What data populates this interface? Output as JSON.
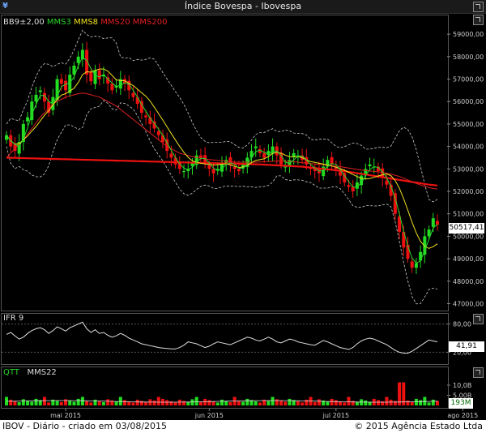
{
  "window": {
    "title": "Índice Bovespa - Ibovespa"
  },
  "legend_price": [
    {
      "label": "BB9±2,00",
      "color": "#dddddd"
    },
    {
      "label": "MMS3",
      "color": "#2bd42b"
    },
    {
      "label": "MMS8",
      "color": "#f0e020"
    },
    {
      "label": "MMS20",
      "color": "#e02020"
    },
    {
      "label": "MMS200",
      "color": "#e02020"
    }
  ],
  "legend_ifr": [
    {
      "label": "IFR 9",
      "color": "#dddddd"
    }
  ],
  "legend_qtt": [
    {
      "label": "QTT",
      "color": "#2bd42b"
    },
    {
      "label": "MMS22",
      "color": "#dddddd"
    }
  ],
  "footer": {
    "left": "IBOV - Diário - criado em 03/08/2015",
    "right": "© 2015 Agência Estado Ltda"
  },
  "colors": {
    "up": "#22dd22",
    "down": "#ee1111",
    "mms3": "#2bd42b",
    "mms8": "#f0e020",
    "mms20": "#dd2020",
    "mms200": "#ee1111",
    "band": "#cccccc",
    "ifr": "#dddddd",
    "mms22": "#dddddd"
  },
  "chart_data": [
    {
      "type": "candlestick",
      "x_labels": [
        "mai 2015",
        "jun 2015",
        "jul 2015",
        "ago 2015"
      ],
      "x_label_index": [
        14,
        48,
        78,
        108
      ],
      "y_ticks": [
        47000,
        48000,
        49000,
        50000,
        51000,
        52000,
        53000,
        54000,
        55000,
        56000,
        57000,
        58000,
        59000
      ],
      "y_tick_labels": [
        "47000,00",
        "48000,00",
        "49000,00",
        "50000,00",
        "51000,00",
        "52000,00",
        "53000,00",
        "54000,00",
        "55000,00",
        "56000,00",
        "57000,00",
        "58000,00",
        "59000,00"
      ],
      "ylim": [
        46800,
        59800
      ],
      "last_value": "50517,41",
      "close": [
        54500,
        54000,
        53800,
        54200,
        55000,
        55300,
        56000,
        56300,
        56500,
        56000,
        55500,
        56200,
        57000,
        56800,
        56500,
        57200,
        57600,
        58000,
        58300,
        57200,
        56900,
        57400,
        57000,
        57200,
        56800,
        56500,
        56700,
        57000,
        56800,
        56500,
        56200,
        55900,
        55500,
        55300,
        55000,
        54800,
        54500,
        54200,
        53800,
        53500,
        53200,
        53000,
        52900,
        53000,
        53300,
        53600,
        53500,
        53300,
        53000,
        52800,
        53000,
        53200,
        53400,
        53200,
        53000,
        52900,
        53200,
        53500,
        53800,
        54000,
        53700,
        53500,
        53800,
        54000,
        53600,
        53200,
        53100,
        53400,
        53700,
        53600,
        53400,
        53200,
        53000,
        52900,
        52800,
        53100,
        53400,
        53200,
        53000,
        52700,
        52400,
        52200,
        52000,
        52400,
        52700,
        53000,
        53200,
        53100,
        52900,
        52600,
        52300,
        51800,
        51000,
        50200,
        49500,
        49000,
        48600,
        48800,
        49300,
        50000,
        50300,
        50800,
        50517
      ],
      "mms20": [
        53500,
        53700,
        53900,
        54100,
        54300,
        54550,
        54800,
        55050,
        55300,
        55500,
        55700,
        55900,
        56000,
        56100,
        56200,
        56250,
        56300,
        56350,
        56380,
        56350,
        56300,
        56250,
        56200,
        56100,
        56000,
        55900,
        55800,
        55650,
        55500,
        55350,
        55200,
        55050,
        54900,
        54750,
        54600,
        54450,
        54300,
        54150,
        54000,
        53900,
        53800,
        53700,
        53650,
        53600,
        53550,
        53500,
        53480,
        53450,
        53420,
        53400,
        53380,
        53360,
        53340,
        53320,
        53300,
        53300,
        53300,
        53300,
        53300,
        53300,
        53310,
        53320,
        53330,
        53340,
        53350,
        53350,
        53340,
        53330,
        53320,
        53300,
        53280,
        53260,
        53240,
        53220,
        53200,
        53180,
        53160,
        53140,
        53120,
        53100,
        53070,
        53040,
        53010,
        52980,
        52950,
        52930,
        52910,
        52890,
        52870,
        52840,
        52810,
        52770,
        52720,
        52660,
        52590,
        52510,
        52430,
        52350,
        52280,
        52220,
        52170,
        52130,
        52100
      ],
      "mms200": [
        53500,
        53495,
        53490,
        53485,
        53480,
        53475,
        53470,
        53465,
        53460,
        53455,
        53450,
        53445,
        53440,
        53435,
        53430,
        53425,
        53420,
        53415,
        53410,
        53405,
        53400,
        53395,
        53390,
        53385,
        53380,
        53375,
        53370,
        53365,
        53360,
        53355,
        53350,
        53345,
        53340,
        53335,
        53330,
        53325,
        53320,
        53315,
        53310,
        53305,
        53300,
        53295,
        53290,
        53285,
        53280,
        53275,
        53270,
        53265,
        53260,
        53255,
        53250,
        53245,
        53240,
        53235,
        53230,
        53225,
        53220,
        53215,
        53210,
        53205,
        53200,
        53190,
        53180,
        53170,
        53160,
        53150,
        53140,
        53130,
        53120,
        53110,
        53100,
        53080,
        53060,
        53040,
        53020,
        53000,
        52980,
        52960,
        52940,
        52920,
        52900,
        52870,
        52840,
        52810,
        52780,
        52750,
        52720,
        52690,
        52660,
        52630,
        52600,
        52570,
        52540,
        52510,
        52480,
        52450,
        52420,
        52390,
        52360,
        52330,
        52300,
        52280,
        52260
      ]
    },
    {
      "type": "line",
      "name": "IFR 9",
      "y_ticks": [
        20,
        80
      ],
      "y_tick_labels": [
        "20,00",
        "80,00"
      ],
      "ylim": [
        0,
        100
      ],
      "last_value": "41,91",
      "values": [
        58,
        62,
        55,
        48,
        52,
        60,
        66,
        70,
        72,
        68,
        60,
        66,
        74,
        70,
        65,
        72,
        76,
        80,
        84,
        70,
        62,
        68,
        60,
        62,
        56,
        52,
        55,
        60,
        56,
        50,
        46,
        42,
        38,
        36,
        34,
        32,
        30,
        29,
        28,
        27,
        27,
        30,
        35,
        42,
        40,
        38,
        34,
        30,
        33,
        38,
        42,
        40,
        38,
        36,
        40,
        44,
        48,
        52,
        50,
        46,
        44,
        48,
        52,
        48,
        42,
        40,
        44,
        48,
        46,
        42,
        40,
        38,
        36,
        35,
        40,
        45,
        42,
        38,
        34,
        30,
        28,
        26,
        30,
        38,
        44,
        48,
        50,
        48,
        44,
        40,
        36,
        30,
        24,
        20,
        18,
        18,
        22,
        28,
        34,
        40,
        46,
        44,
        42
      ],
      "threshold_label": "80,00"
    },
    {
      "type": "bar",
      "name": "QTT",
      "y_ticks": [
        5000000000,
        10000000000
      ],
      "y_tick_labels": [
        "5,00B",
        "10,0B"
      ],
      "last_value": "193M"
    }
  ]
}
